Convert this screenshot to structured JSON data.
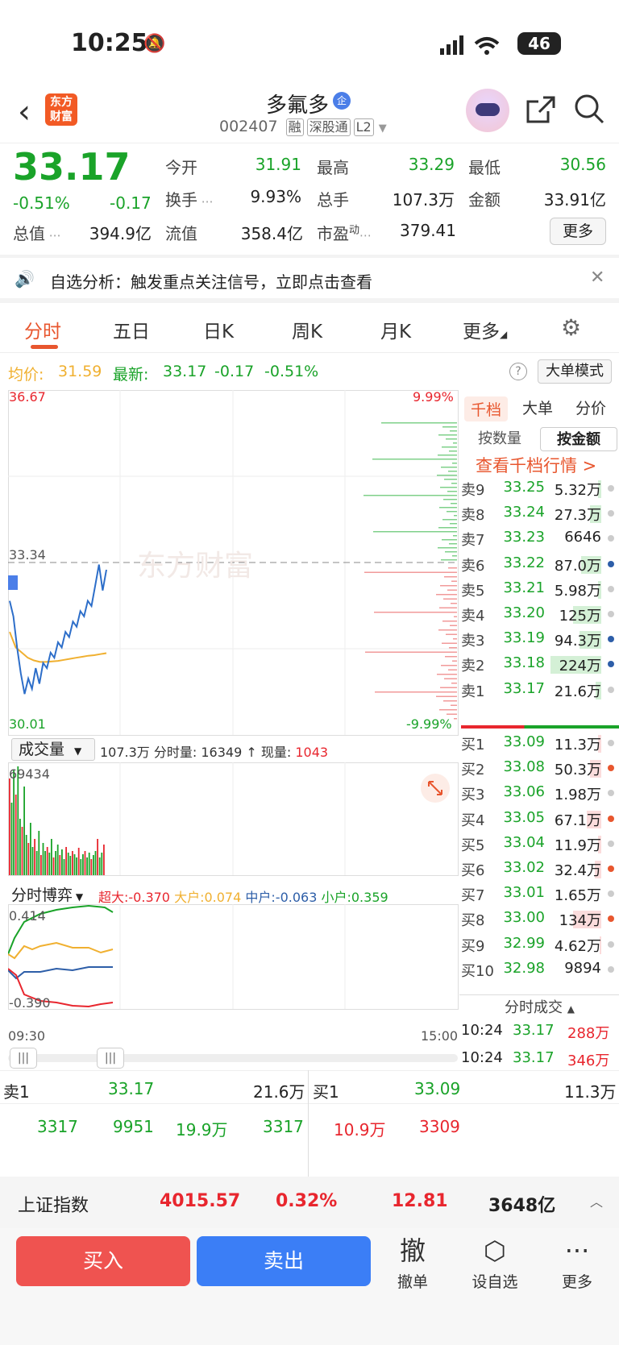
{
  "status": {
    "time": "10:25",
    "battery": "46"
  },
  "header": {
    "name": "多氟多",
    "badge": "企",
    "code": "002407",
    "tags": [
      "融",
      "深股通",
      "L2"
    ],
    "logo": "东方财富"
  },
  "quote": {
    "price": "33.17",
    "change_pct": "-0.51%",
    "change": "-0.17",
    "fields": [
      {
        "label": "今开",
        "value": "31.91",
        "color": "green"
      },
      {
        "label": "最高",
        "value": "33.29",
        "color": "green"
      },
      {
        "label": "最低",
        "value": "30.56",
        "color": "green"
      },
      {
        "label": "换手",
        "value": "9.93%",
        "color": "dark"
      },
      {
        "label": "总手",
        "value": "107.3万",
        "color": "dark"
      },
      {
        "label": "金额",
        "value": "33.91亿",
        "color": "dark"
      },
      {
        "label": "总值",
        "value": "394.9亿",
        "color": "dark"
      },
      {
        "label": "流值",
        "value": "358.4亿",
        "color": "dark"
      },
      {
        "label": "市盈",
        "value": "379.41",
        "color": "dark"
      }
    ],
    "pe_sup": "动",
    "more": "更多"
  },
  "notice": {
    "text": "自选分析：触发重点关注信号，立即点击查看"
  },
  "tabs": [
    "分时",
    "五日",
    "日K",
    "周K",
    "月K",
    "更多"
  ],
  "info": {
    "avg_label": "均价:",
    "avg": "31.59",
    "last_label": "最新:",
    "last": "33.17",
    "chg": "-0.17",
    "pct": "-0.51%",
    "mode_btn": "大单模式"
  },
  "chart": {
    "y_top": "36.67",
    "y_mid": "33.34",
    "y_bot": "30.01",
    "pct_top": "9.99%",
    "pct_bot": "-9.99%",
    "watermark": "东方财富",
    "vol_title": "成交量",
    "vol_info": "107.3万 分时量: 16349 ↑ 现量:",
    "vol_now": "1043",
    "vol_max": "69434",
    "game_title": "分时博弈",
    "game": [
      {
        "name": "超大:",
        "value": "-0.370",
        "color": "#e8262e"
      },
      {
        "name": "大户:",
        "value": "0.074",
        "color": "#f0b030"
      },
      {
        "name": "中户:",
        "value": "-0.063",
        "color": "#2d5ea8"
      },
      {
        "name": "小户:",
        "value": "0.359",
        "color": "#1aa329"
      }
    ],
    "game_top": "0.414",
    "game_bot": "-0.390",
    "t_start": "09:30",
    "t_end": "15:00"
  },
  "chart_data": {
    "type": "line",
    "title": "",
    "series": [
      {
        "name": "",
        "values": [
          32.6,
          32.3,
          31.7,
          31.2,
          30.8,
          31.1,
          30.9,
          31.3,
          31.0,
          31.4,
          31.3,
          31.6,
          31.5,
          31.8,
          31.7,
          32.0,
          31.9,
          32.2,
          32.1,
          32.4,
          32.3,
          32.6,
          32.5,
          32.9,
          33.3,
          32.8,
          33.2
        ]
      },
      {
        "name": "",
        "values": [
          32.0,
          31.7,
          31.6,
          31.5,
          31.45,
          31.42,
          31.42,
          31.43,
          31.44,
          31.46,
          31.48,
          31.5,
          31.52,
          31.54,
          31.55,
          31.57,
          31.59
        ]
      }
    ],
    "ylim": [
      30.01,
      36.67
    ]
  },
  "orderbook": {
    "tabs": [
      "千档",
      "大单",
      "分价"
    ],
    "modes": [
      "按数量",
      "按金额"
    ],
    "link": "查看千档行情 >",
    "asks": [
      {
        "label": "卖9",
        "price": "33.25",
        "vol": "5.32万",
        "bar": 0.05,
        "dot": "#ccc"
      },
      {
        "label": "卖8",
        "price": "33.24",
        "vol": "27.3万",
        "bar": 0.2,
        "dot": "#ccc"
      },
      {
        "label": "卖7",
        "price": "33.23",
        "vol": "6646",
        "bar": 0.0,
        "dot": "#ccc"
      },
      {
        "label": "卖6",
        "price": "33.22",
        "vol": "87.0万",
        "bar": 0.35,
        "dot": "#2d5ea8"
      },
      {
        "label": "卖5",
        "price": "33.21",
        "vol": "5.98万",
        "bar": 0.05,
        "dot": "#ccc"
      },
      {
        "label": "卖4",
        "price": "33.20",
        "vol": "125万",
        "bar": 0.5,
        "dot": "#ccc"
      },
      {
        "label": "卖3",
        "price": "33.19",
        "vol": "94.3万",
        "bar": 0.38,
        "dot": "#2d5ea8"
      },
      {
        "label": "卖2",
        "price": "33.18",
        "vol": "224万",
        "bar": 0.9,
        "dot": "#2d5ea8"
      },
      {
        "label": "卖1",
        "price": "33.17",
        "vol": "21.6万",
        "bar": 0.1,
        "dot": "#ccc"
      }
    ],
    "bids": [
      {
        "label": "买1",
        "price": "33.09",
        "vol": "11.3万",
        "bar": 0.05,
        "dot": "#ccc"
      },
      {
        "label": "买2",
        "price": "33.08",
        "vol": "50.3万",
        "bar": 0.2,
        "dot": "#e8562e"
      },
      {
        "label": "买3",
        "price": "33.06",
        "vol": "1.98万",
        "bar": 0.0,
        "dot": "#ccc"
      },
      {
        "label": "买4",
        "price": "33.05",
        "vol": "67.1万",
        "bar": 0.25,
        "dot": "#e8562e"
      },
      {
        "label": "买5",
        "price": "33.04",
        "vol": "11.9万",
        "bar": 0.05,
        "dot": "#ccc"
      },
      {
        "label": "买6",
        "price": "33.02",
        "vol": "32.4万",
        "bar": 0.12,
        "dot": "#e8562e"
      },
      {
        "label": "买7",
        "price": "33.01",
        "vol": "1.65万",
        "bar": 0.0,
        "dot": "#ccc"
      },
      {
        "label": "买8",
        "price": "33.00",
        "vol": "134万",
        "bar": 0.5,
        "dot": "#e8562e"
      },
      {
        "label": "买9",
        "price": "32.99",
        "vol": "4.62万",
        "bar": 0.03,
        "dot": "#ccc"
      },
      {
        "label": "买10",
        "price": "32.98",
        "vol": "9894",
        "bar": 0.0,
        "dot": "#ccc"
      }
    ],
    "trades_title": "分时成交",
    "trades": [
      {
        "time": "10:24",
        "price": "33.17",
        "vol": "288万"
      },
      {
        "time": "10:24",
        "price": "33.17",
        "vol": "346万"
      }
    ]
  },
  "level1": {
    "sell_label": "卖1",
    "sell_price": "33.17",
    "sell_vol": "21.6万",
    "buy_label": "买1",
    "buy_price": "33.09",
    "buy_vol": "11.3万",
    "row2": [
      "3317",
      "9951",
      "19.9万",
      "3317",
      "10.9万",
      "3309"
    ]
  },
  "index": {
    "name": "上证指数",
    "value": "4015.57",
    "pct": "0.32%",
    "chg": "12.81",
    "amount": "3648亿"
  },
  "actions": {
    "buy": "买入",
    "sell": "卖出",
    "cancel_icon": "撤",
    "cancel": "撤单",
    "set_fav": "设自选",
    "more": "更多"
  }
}
